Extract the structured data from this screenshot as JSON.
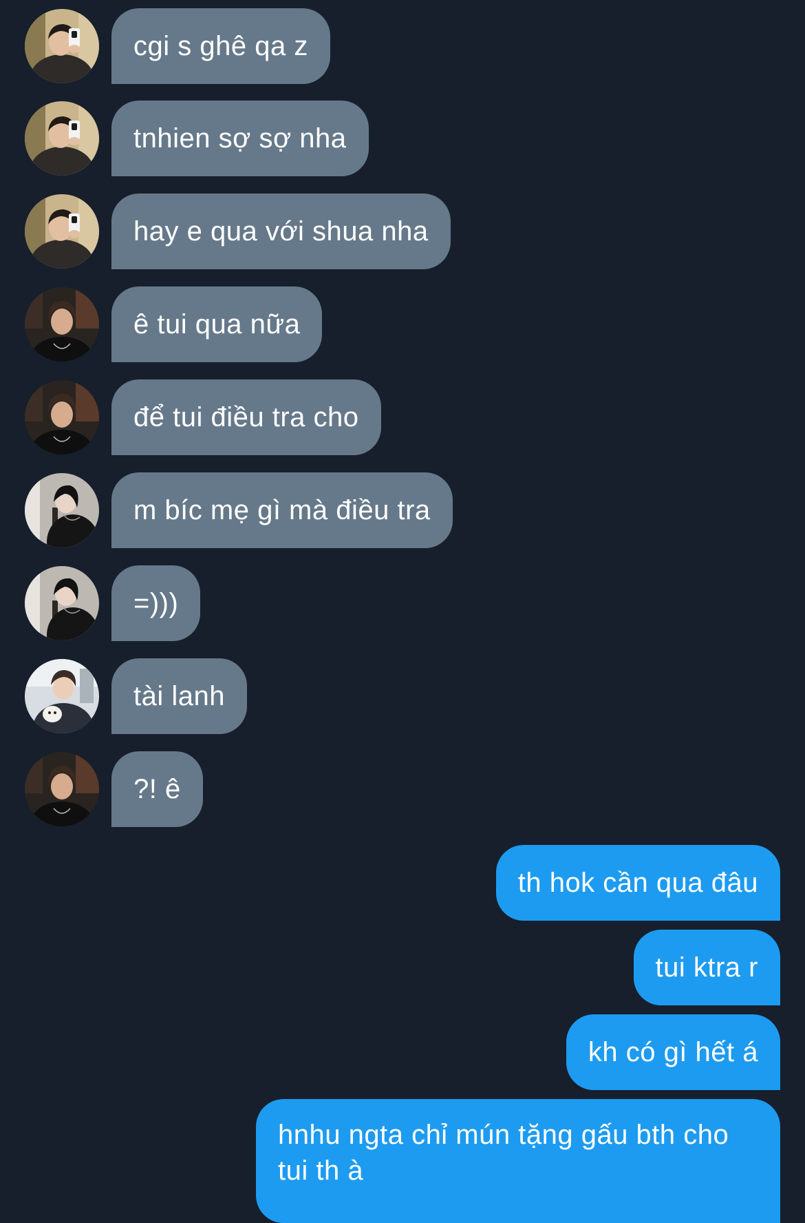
{
  "messages": [
    {
      "side": "in",
      "avatar": "avatar-a",
      "text": "cgi s ghê qa z"
    },
    {
      "side": "in",
      "avatar": "avatar-a",
      "text": "tnhien sợ sợ nha"
    },
    {
      "side": "in",
      "avatar": "avatar-a",
      "text": "hay e qua với shua nha"
    },
    {
      "side": "in",
      "avatar": "avatar-b",
      "text": "ê tui qua nữa"
    },
    {
      "side": "in",
      "avatar": "avatar-b",
      "text": "để tui điều tra cho"
    },
    {
      "side": "in",
      "avatar": "avatar-c",
      "text": "m bíc mẹ gì mà điều tra"
    },
    {
      "side": "in",
      "avatar": "avatar-c",
      "text": "=)))"
    },
    {
      "side": "in",
      "avatar": "avatar-d",
      "text": "tài lanh"
    },
    {
      "side": "in",
      "avatar": "avatar-b",
      "text": "?! ê"
    },
    {
      "side": "out",
      "text": "th hok cần qua đâu"
    },
    {
      "side": "out",
      "text": "tui ktra r"
    },
    {
      "side": "out",
      "text": "kh có gì hết á"
    },
    {
      "side": "out",
      "text": "hnhu ngta chỉ mún tặng gấu bth cho tui th à"
    }
  ],
  "colors": {
    "background": "#161f2b",
    "incoming_bubble": "#66798a",
    "outgoing_bubble": "#1d9bf0",
    "text": "#ffffff"
  }
}
